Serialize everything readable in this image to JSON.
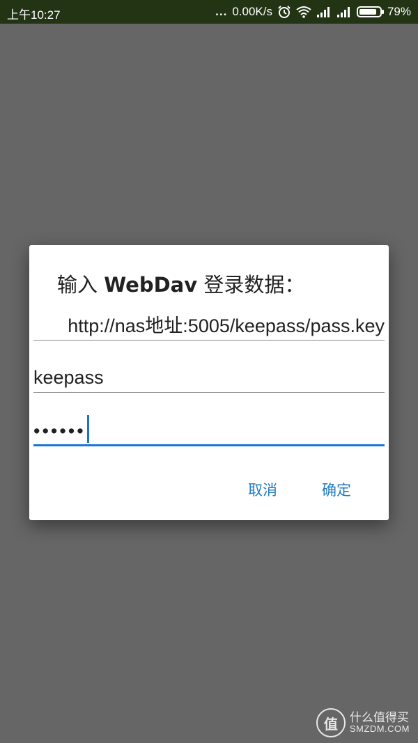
{
  "status_bar": {
    "time": "上午10:27",
    "dots": "...",
    "network_speed": "0.00K/s",
    "battery_percent": "79%",
    "icons": [
      "alarm-icon",
      "wifi-icon",
      "signal-icon",
      "signal-icon",
      "battery-icon"
    ]
  },
  "dialog": {
    "title_prefix": "输入 ",
    "title_bold": "WebDav",
    "title_suffix": " 登录数据：",
    "url_value": "http://nas地址:5005/keepass/pass.key",
    "username_value": "keepass",
    "password_mask": "••••••",
    "cancel_label": "取消",
    "ok_label": "确定"
  },
  "watermark": {
    "logo_char": "值",
    "cn_text": "什么值得买",
    "en_text": "SMZDM.COM"
  },
  "colors": {
    "status_bar_bg": "#223414",
    "backdrop": "#666666",
    "accent": "#1976d2",
    "button_text": "#1f7bc1"
  }
}
